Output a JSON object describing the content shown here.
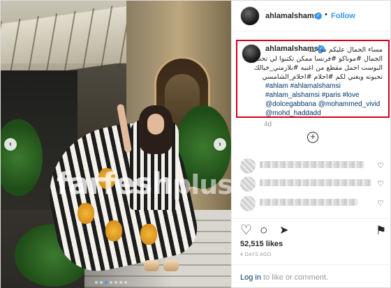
{
  "header": {
    "username": "ahlamalshamsi",
    "separator": "•",
    "follow_label": "Follow",
    "verified_mark": "✓"
  },
  "watermark": {
    "part1": "farfesh",
    "part2": "plus.com"
  },
  "photo_nav": {
    "prev": "‹",
    "next": "›"
  },
  "caption": {
    "username": "ahlamalshamsi",
    "lines_rtl": [
      "مساء الجمال عليكم من بلد",
      "الجمال #موناكو  #فرنسا ممكن تكتبوا لي تحت هذا",
      "البوست اجمل مقطع من اغنيه  #بلازمني_خيالك",
      "تحبونه ويغني لكم #احلام #احلام_الشامسي"
    ],
    "lines_ltr": [
      "#ahlam #ahlamalshamsi",
      "#ahlam_alshamsi #paris #love",
      "@dolcegabbana @mohammed_vivid",
      "@mohd_haddadd"
    ]
  },
  "post_meta": {
    "time_ago": "4d",
    "reply_icon": "+"
  },
  "comment_heart": "♡",
  "actions": {
    "like_icon": "♡",
    "comment_icon": "○",
    "share_icon": "➤",
    "save_icon": "⚑"
  },
  "likes": "52,515 likes",
  "date": "4 DAYS AGO",
  "login": {
    "link_text": "Log in",
    "rest": " to like or comment."
  },
  "colors": {
    "accent": "#3897f0",
    "highlight_border": "#d0021b",
    "hashtag": "#003569"
  }
}
